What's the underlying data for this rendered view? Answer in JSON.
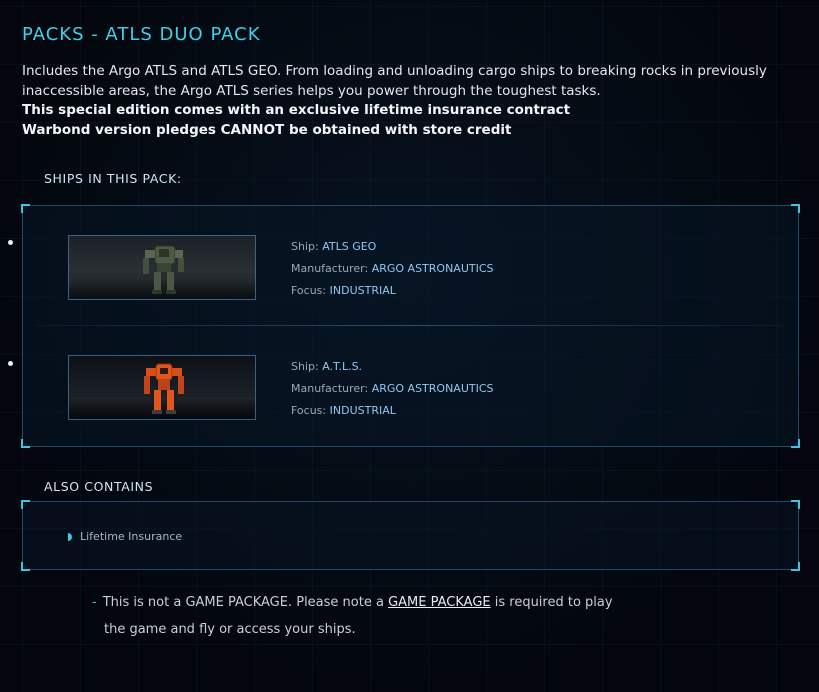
{
  "title": "PACKS - ATLS DUO PACK",
  "description": {
    "text": "Includes the Argo ATLS and ATLS GEO. From loading and unloading cargo ships to breaking rocks in previously inaccessible areas, the Argo ATLS series helps you power through the toughest tasks.",
    "insurance_line": "This special edition comes with an exclusive lifetime insurance contract",
    "warbond_line": "Warbond version pledges CANNOT be obtained with store credit"
  },
  "ships_section": {
    "label": "SHIPS IN THIS PACK:",
    "field_labels": {
      "ship": "Ship: ",
      "manufacturer": "Manufacturer: ",
      "focus": "Focus: "
    },
    "ships": [
      {
        "name": "ATLS GEO",
        "manufacturer": "ARGO ASTRONAUTICS",
        "focus": "INDUSTRIAL",
        "image_icon": "atls-geo-mech-image"
      },
      {
        "name": "A.T.L.S.",
        "manufacturer": "ARGO ASTRONAUTICS",
        "focus": "INDUSTRIAL",
        "image_icon": "atls-mech-image"
      }
    ]
  },
  "also_contains": {
    "label": "ALSO CONTAINS",
    "items": [
      "Lifetime Insurance"
    ]
  },
  "note": {
    "prefix": "This is not a GAME PACKAGE. Please note a ",
    "link": "GAME PACKAGE",
    "suffix": " is required to play",
    "line2": "the game and fly or access your ships."
  },
  "colors": {
    "accent": "#3fd0ec",
    "value_blue": "#8fc9f2",
    "background": "#03070d",
    "geo_mech": "#4a5a44",
    "atls_mech": "#e2561c"
  }
}
